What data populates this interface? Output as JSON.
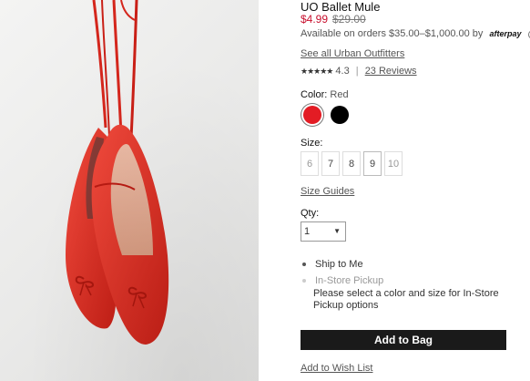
{
  "product": {
    "title": "UO Ballet Mule",
    "sale_price": "$4.99",
    "original_price": "$29.00",
    "afterpay_text": "Available on orders $35.00–$1,000.00 by",
    "afterpay_logo": "afterpay",
    "see_all_link": "See all Urban Outfitters",
    "rating_stars": "★★★★★",
    "rating_value": "4.3",
    "rating_separator": "|",
    "reviews_link": "23 Reviews"
  },
  "color": {
    "label": "Color:",
    "selected": "Red",
    "swatches": [
      {
        "name": "Red",
        "hex": "#e31c24",
        "selected": true
      },
      {
        "name": "Black",
        "hex": "#000000",
        "selected": false
      }
    ]
  },
  "size": {
    "label": "Size:",
    "options": [
      "6",
      "7",
      "8",
      "9",
      "10"
    ],
    "guide_link": "Size Guides"
  },
  "qty": {
    "label": "Qty:",
    "value": "1"
  },
  "fulfillment": {
    "ship_label": "Ship to Me",
    "pickup_label": "In-Store Pickup",
    "pickup_note": "Please select a color and size for In-Store Pickup options"
  },
  "actions": {
    "add_to_bag": "Add to Bag",
    "wish_list": "Add to Wish List"
  },
  "colors": {
    "sale_red": "#c8102e",
    "button_black": "#1a1a1a",
    "shoe_red": "#e0372b"
  }
}
